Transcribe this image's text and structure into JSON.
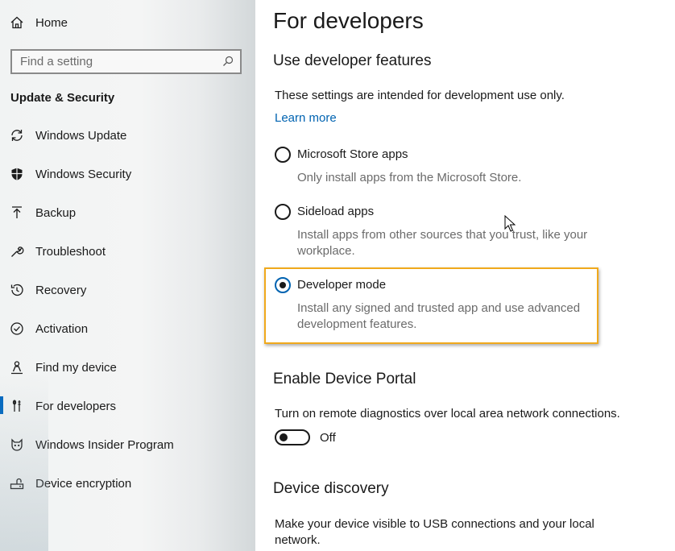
{
  "sidebar": {
    "home_label": "Home",
    "search_placeholder": "Find a setting",
    "section_heading": "Update & Security",
    "items": [
      {
        "label": "Windows Update",
        "icon": "refresh-icon"
      },
      {
        "label": "Windows Security",
        "icon": "shield-icon"
      },
      {
        "label": "Backup",
        "icon": "upload-icon"
      },
      {
        "label": "Troubleshoot",
        "icon": "wrench-icon"
      },
      {
        "label": "Recovery",
        "icon": "history-icon"
      },
      {
        "label": "Activation",
        "icon": "check-circle-icon"
      },
      {
        "label": "Find my device",
        "icon": "person-pin-icon"
      },
      {
        "label": "For developers",
        "icon": "developer-tools-icon",
        "active": true
      },
      {
        "label": "Windows Insider Program",
        "icon": "insider-cat-icon"
      },
      {
        "label": "Device encryption",
        "icon": "drive-lock-icon"
      }
    ]
  },
  "main": {
    "title": "For developers",
    "use_features": {
      "heading": "Use developer features",
      "description": "These settings are intended for development use only.",
      "learn_more": "Learn more",
      "options": [
        {
          "label": "Microsoft Store apps",
          "desc": "Only install apps from the Microsoft Store.",
          "checked": false
        },
        {
          "label": "Sideload apps",
          "desc": "Install apps from other sources that you trust, like your workplace.",
          "checked": false
        },
        {
          "label": "Developer mode",
          "desc": "Install any signed and trusted app and use advanced development features.",
          "checked": true
        }
      ]
    },
    "device_portal": {
      "heading": "Enable Device Portal",
      "description": "Turn on remote diagnostics over local area network connections.",
      "toggle_state": "Off"
    },
    "device_discovery": {
      "heading": "Device discovery",
      "description": "Make your device visible to USB connections and your local network."
    }
  },
  "colors": {
    "accent": "#0063b1",
    "highlight_border": "#f0a91c"
  }
}
